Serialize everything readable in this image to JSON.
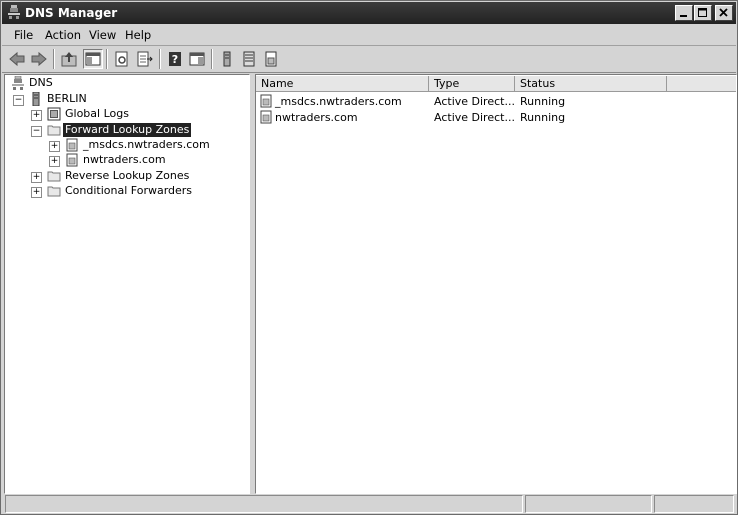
{
  "window": {
    "title": "DNS Manager"
  },
  "menu": [
    "File",
    "Action",
    "View",
    "Help"
  ],
  "tree": {
    "root": "DNS",
    "server": "BERLIN",
    "global_logs": "Global Logs",
    "forward_zones": "Forward Lookup Zones",
    "zone1": "_msdcs.nwtraders.com",
    "zone2": "nwtraders.com",
    "reverse_zones": "Reverse Lookup Zones",
    "cond_forwarders": "Conditional Forwarders"
  },
  "list": {
    "columns": [
      "Name",
      "Type",
      "Status"
    ],
    "rows": [
      {
        "name": "_msdcs.nwtraders.com",
        "type": "Active Direct...",
        "status": "Running"
      },
      {
        "name": "nwtraders.com",
        "type": "Active Direct...",
        "status": "Running"
      }
    ]
  }
}
